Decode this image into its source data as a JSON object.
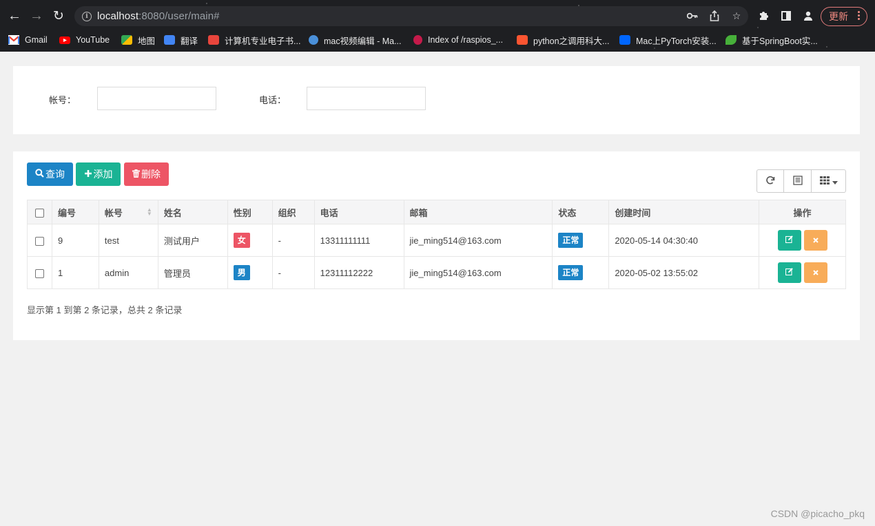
{
  "browser": {
    "url_host": "localhost",
    "url_path": ":8080/user/main#",
    "update_label": "更新",
    "bookmarks": [
      {
        "label": "Gmail",
        "color": "#ea4335"
      },
      {
        "label": "YouTube",
        "color": "#ff0000"
      },
      {
        "label": "地图",
        "color": "#34a853"
      },
      {
        "label": "翻译",
        "color": "#4285f4"
      },
      {
        "label": "计算机专业电子书...",
        "color": "#e8453c"
      },
      {
        "label": "mac视频编辑 - Ma...",
        "color": "#4a90d9"
      },
      {
        "label": "Index of /raspios_...",
        "color": "#c51a4a"
      },
      {
        "label": "python之调用科大...",
        "color": "#fc5531"
      },
      {
        "label": "Mac上PyTorch安装...",
        "color": "#0066ff"
      },
      {
        "label": "基于SpringBoot实...",
        "color": "#47b03a"
      }
    ]
  },
  "search": {
    "account_label": "帐号：",
    "phone_label": "电话：",
    "account_value": "",
    "phone_value": ""
  },
  "toolbar": {
    "query_label": "查询",
    "add_label": "添加",
    "delete_label": "删除"
  },
  "table": {
    "headers": {
      "id": "编号",
      "account": "帐号",
      "name": "姓名",
      "gender": "性别",
      "org": "组织",
      "phone": "电话",
      "email": "邮箱",
      "status": "状态",
      "created": "创建时间",
      "actions": "操作"
    },
    "rows": [
      {
        "id": "9",
        "account": "test",
        "name": "测试用户",
        "gender": "女",
        "org": "-",
        "phone": "13311111111",
        "email": "jie_ming514@163.com",
        "status": "正常",
        "created": "2020-05-14 04:30:40"
      },
      {
        "id": "1",
        "account": "admin",
        "name": "管理员",
        "gender": "男",
        "org": "-",
        "phone": "12311112222",
        "email": "jie_ming514@163.com",
        "status": "正常",
        "created": "2020-05-02 13:55:02"
      }
    ]
  },
  "pagination": {
    "summary": "显示第 1 到第 2 条记录，总共 2 条记录"
  },
  "watermark": "CSDN @picacho_pkq",
  "colors": {
    "primary": "#1c84c6",
    "success": "#1ab394",
    "danger": "#ed5565",
    "warning": "#f8ac59"
  }
}
